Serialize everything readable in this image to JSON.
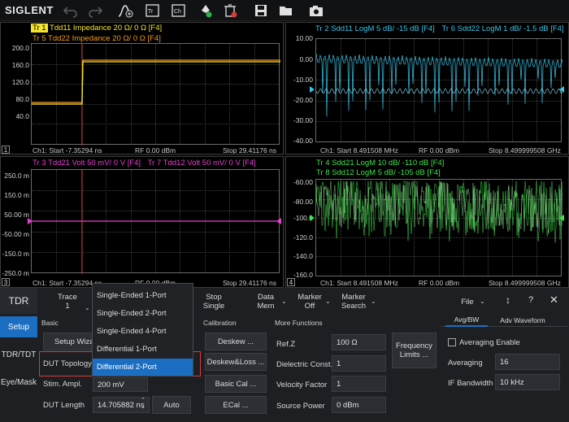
{
  "brand": "SIGLENT",
  "toolbar_icons": [
    "undo-icon",
    "redo-icon",
    "autoscale-icon",
    "trace-add-icon",
    "channel-add-icon",
    "marker-search-icon",
    "delete-icon",
    "save-icon",
    "open-folder-icon",
    "camera-icon"
  ],
  "panels": {
    "p1": {
      "number": "1",
      "traces": [
        {
          "tag": "Tr 1",
          "text": "Tdd11  Impedance  20 Ω/  0 Ω  [F4]",
          "color": "#f4e52b"
        },
        {
          "tag": "Tr 5",
          "text": "Tdd22  Impedance  20 Ω/  0 Ω  [F4]",
          "color": "#f29a1a"
        }
      ],
      "yticks": [
        "200.0",
        "160.0",
        "120.0",
        "80.0",
        "40.0",
        ""
      ],
      "footer": {
        "start": "Ch1: Start -7.35294 ns",
        "mid": "RF 0.00 dBm",
        "stop": "Stop 29.41176 ns"
      }
    },
    "p2": {
      "number": "2",
      "traces": [
        {
          "tag": "Tr 2",
          "text": "Sdd11  LogM  5 dB/  -15 dB  [F4]",
          "color": "#35c6ea"
        },
        {
          "tag": "Tr 6",
          "text": "Sdd22  LogM  1 dB/  -1.5 dB  [F4]",
          "color": "#35c6ea"
        }
      ],
      "yticks": [
        "10.00",
        "0.00",
        "-10.00",
        "-20.00",
        "-30.00",
        "-40.00"
      ],
      "footer": {
        "start": "Ch1: Start 8.491508 MHz",
        "mid": "RF 0.00 dBm",
        "stop": "Stop 8.499999508 GHz"
      }
    },
    "p3": {
      "number": "3",
      "traces": [
        {
          "tag": "Tr 3",
          "text": "Tdd21  Volt  50 mV/  0 V  [F4]",
          "color": "#e83fd0"
        },
        {
          "tag": "Tr 7",
          "text": "Tdd12  Volt  50 mV/  0 V  [F4]",
          "color": "#e83fd0"
        }
      ],
      "yticks": [
        "250.0 m",
        "150.0 m",
        "50.00 m",
        "-50.00 m",
        "-150.0 m",
        "-250.0 m"
      ],
      "footer": {
        "start": "Ch1: Start -7.35294 ns",
        "mid": "RF 0.00 dBm",
        "stop": "Stop 29.41176 ns"
      }
    },
    "p4": {
      "number": "4",
      "traces": [
        {
          "tag": "Tr 4",
          "text": "Sdd21  LogM  10 dB/  -110 dB  [F4]",
          "color": "#3fe34a"
        },
        {
          "tag": "Tr 8",
          "text": "Sdd12  LogM  5 dB/  -105 dB  [F4]",
          "color": "#3fe34a"
        }
      ],
      "yticks": [
        "-60.00",
        "-80.00",
        "-100.0",
        "-120.0",
        "-140.0",
        "-160.0"
      ],
      "footer": {
        "start": "Ch1: Start 8.491508 MHz",
        "mid": "RF 0.00 dBm",
        "stop": "Stop 8.499999508 GHz"
      }
    }
  },
  "controls": {
    "title": "TDR",
    "side_tabs": [
      "Setup",
      "TDR/TDT",
      "Eye/Mask"
    ],
    "top_menu": {
      "trace": [
        "Trace",
        "1"
      ],
      "stop_single": [
        "Stop",
        "Single"
      ],
      "data_mem": [
        "Data",
        "Mem"
      ],
      "marker_off": [
        "Marker",
        "Off"
      ],
      "marker_search": [
        "Marker",
        "Search"
      ],
      "file": "File"
    },
    "sections": {
      "basic": "Basic",
      "calibration": "Calibration",
      "more": "More Functions"
    },
    "basic": {
      "setup_wizard": "Setup Wiza",
      "dut_topology": "DUT Topology",
      "stim_ampl": "Stim. Ampl.",
      "stim_ampl_value": "200 mV",
      "dut_length": "DUT Length",
      "dut_length_value": "14.705882 ns",
      "auto": "Auto"
    },
    "dropdown": [
      "Single-Ended 1-Port",
      "Single-Ended 2-Port",
      "Single-Ended 4-Port",
      "Differential 1-Port",
      "Differential 2-Port"
    ],
    "calibration": [
      "Deskew ...",
      "Deskew&Loss ...",
      "Basic Cal ...",
      "ECal ..."
    ],
    "more": {
      "refz": "Ref.Z",
      "refz_value": "100 Ω",
      "dielectric": "Dielectric Const.",
      "dielectric_value": "1",
      "velocity": "Velocity Factor",
      "velocity_value": "1",
      "source_power": "Source Power",
      "source_power_value": "0 dBm",
      "freq_limits": [
        "Frequency",
        "Limits ..."
      ]
    },
    "right": {
      "tabs": [
        "Avg/BW",
        "Adv Waveform"
      ],
      "averaging_enable": "Averaging Enable",
      "averaging": "Averaging",
      "averaging_value": "16",
      "if_bw": "IF Bandwidth",
      "if_bw_value": "10 kHz"
    }
  }
}
